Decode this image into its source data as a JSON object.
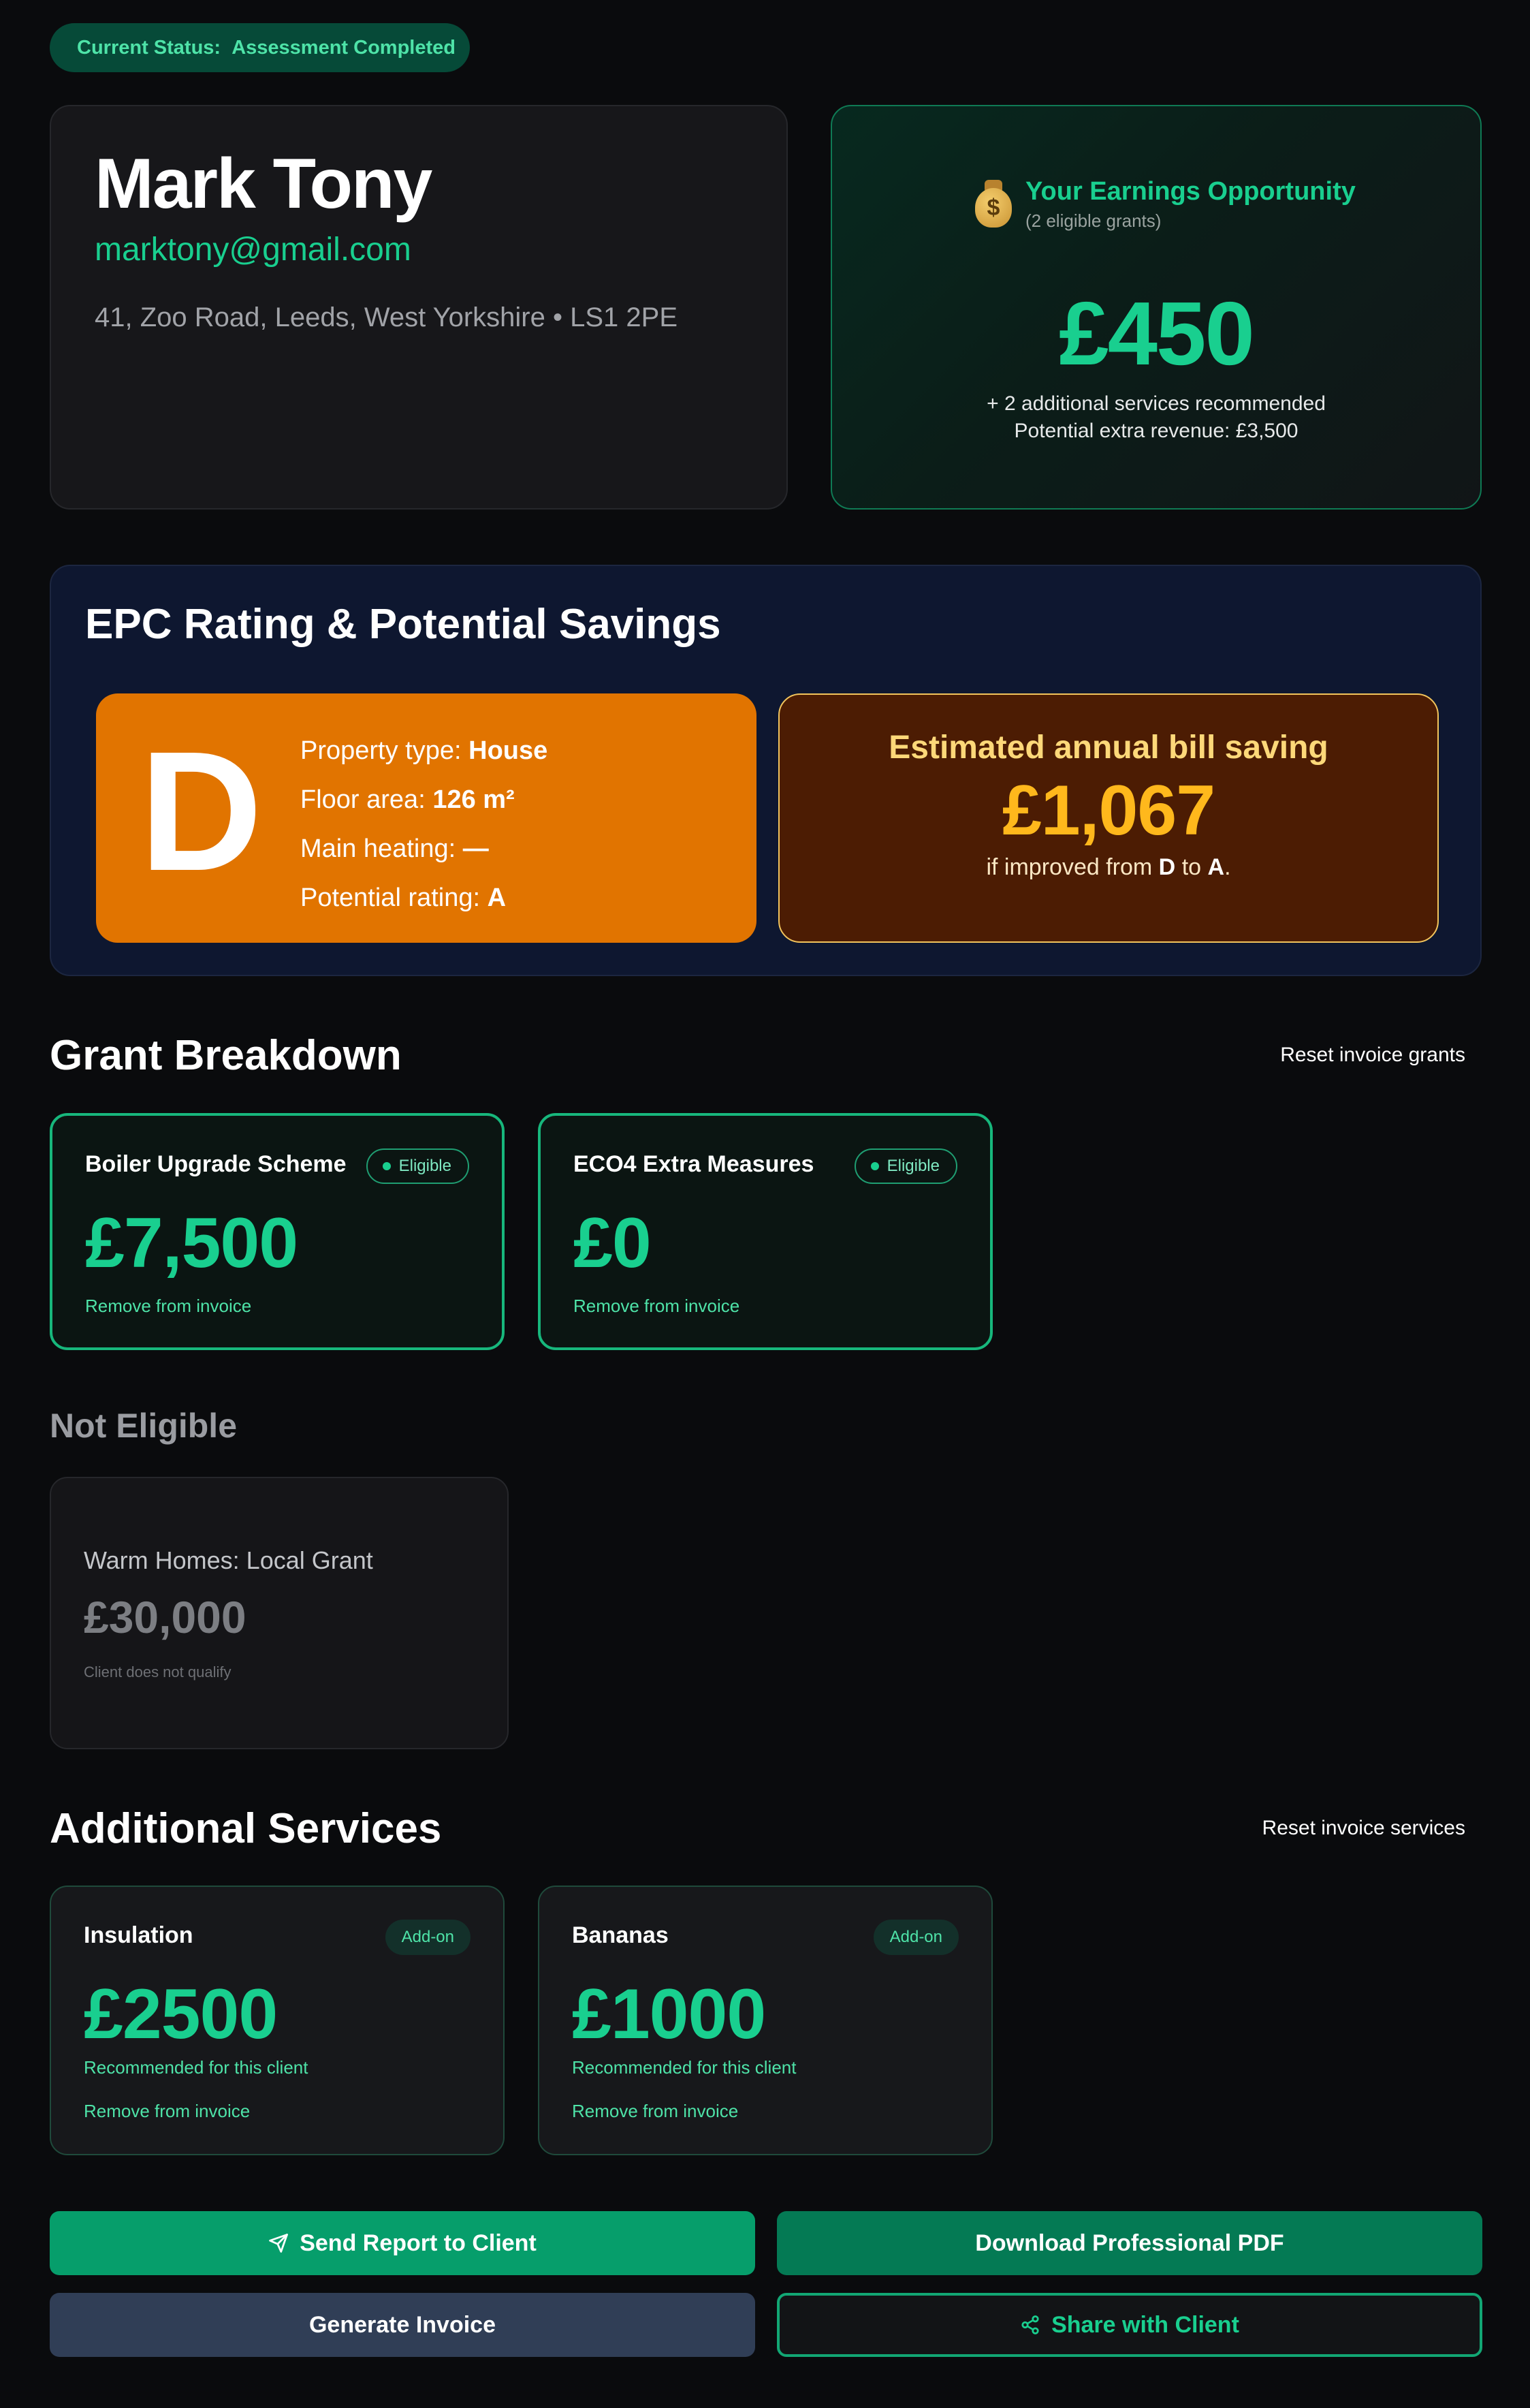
{
  "status": {
    "label": "Current Status:",
    "value": "Assessment Completed"
  },
  "client": {
    "name": "Mark Tony",
    "email": "marktony@gmail.com",
    "address": "41, Zoo Road, Leeds, West Yorkshire • LS1 2PE"
  },
  "earnings": {
    "title": "Your Earnings Opportunity",
    "subtitle": "(2 eligible grants)",
    "amount": "£450",
    "note_services": "+ 2 additional services recommended",
    "note_revenue": "Potential extra revenue: £3,500",
    "icon": "money-bag-icon"
  },
  "epc": {
    "title": "EPC Rating & Potential Savings",
    "rating": "D",
    "property_type_label": "Property type:",
    "property_type": "House",
    "floor_area_label": "Floor area:",
    "floor_area": "126 m²",
    "main_heating_label": "Main heating:",
    "main_heating": "—",
    "potential_rating_label": "Potential rating:",
    "potential_rating": "A",
    "saving_title": "Estimated annual bill saving",
    "saving_amount": "£1,067",
    "saving_note_prefix": "if improved from",
    "saving_from": "D",
    "saving_note_mid": "to",
    "saving_to": "A",
    "saving_note_suffix": "."
  },
  "grants": {
    "title": "Grant Breakdown",
    "reset_label": "Reset invoice grants",
    "items": [
      {
        "name": "Boiler Upgrade Scheme",
        "badge": "Eligible",
        "amount": "£7,500",
        "action": "Remove from invoice"
      },
      {
        "name": "ECO4 Extra Measures",
        "badge": "Eligible",
        "amount": "£0",
        "action": "Remove from invoice"
      }
    ]
  },
  "not_eligible": {
    "title": "Not Eligible",
    "items": [
      {
        "name": "Warm Homes: Local Grant",
        "amount": "£30,000",
        "note": "Client does not qualify"
      }
    ]
  },
  "services": {
    "title": "Additional Services",
    "reset_label": "Reset invoice services",
    "items": [
      {
        "name": "Insulation",
        "badge": "Add-on",
        "amount": "£2500",
        "note": "Recommended for this client",
        "action": "Remove from invoice"
      },
      {
        "name": "Bananas",
        "badge": "Add-on",
        "amount": "£1000",
        "note": "Recommended for this client",
        "action": "Remove from invoice"
      }
    ]
  },
  "actions": {
    "send_label": "Send Report to Client",
    "pdf_label": "Download Professional PDF",
    "invoice_label": "Generate Invoice",
    "share_label": "Share with Client"
  },
  "colors": {
    "accent": "#19cf8f",
    "epc_d": "#e17400",
    "saving_bg": "#4c1c03",
    "saving_amount": "#ffb81c"
  }
}
